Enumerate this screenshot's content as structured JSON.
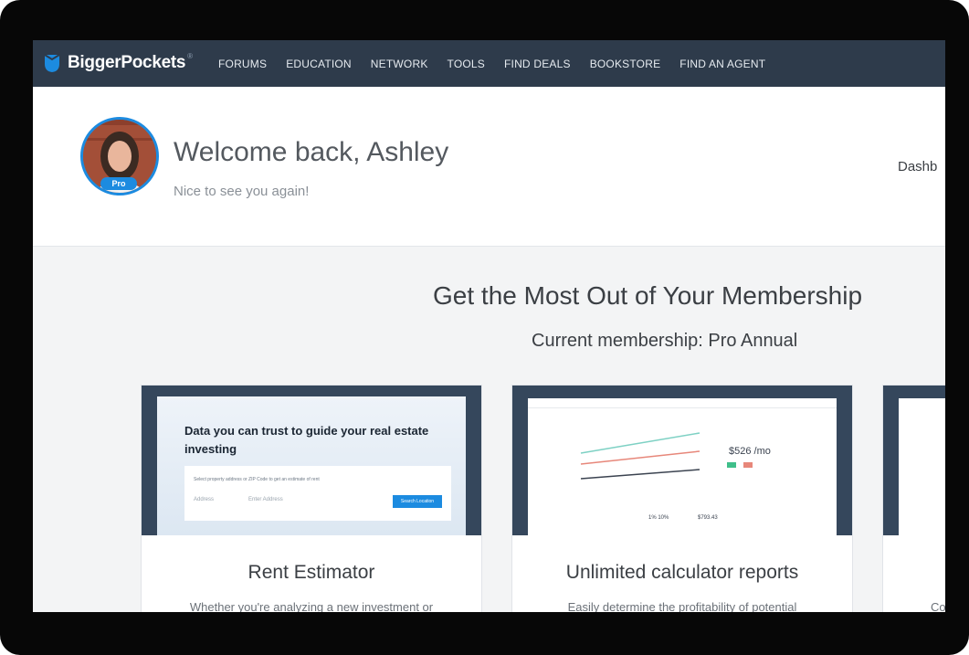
{
  "nav": {
    "brand": "BiggerPockets",
    "brand_mark": "®",
    "items": [
      "FORUMS",
      "EDUCATION",
      "NETWORK",
      "TOOLS",
      "FIND DEALS",
      "BOOKSTORE",
      "FIND AN AGENT"
    ]
  },
  "welcome": {
    "title": "Welcome back, Ashley",
    "subtitle": "Nice to see you again!",
    "badge": "Pro",
    "dashboard_link": "Dashb"
  },
  "membership": {
    "heading": "Get the Most Out of Your Membership",
    "current": "Current membership: Pro Annual"
  },
  "cards": [
    {
      "title": "Rent Estimator",
      "desc": "Whether you're analyzing a new investment or",
      "hero": {
        "headline": "Data you can trust to guide your real estate investing",
        "form_label": "Select property address or ZIP Code to get an estimate of rent",
        "field1": "Address",
        "field2": "Enter Address",
        "button": "Search Location"
      }
    },
    {
      "title": "Unlimited calculator reports",
      "desc": "Easily determine the profitability of potential",
      "hero": {
        "big_value": "$526 /mo",
        "stat1": "1% 10%",
        "stat2": "$793.43"
      }
    },
    {
      "title": "",
      "desc": "Co"
    }
  ],
  "colors": {
    "nav_bg": "#2e3b4b",
    "accent": "#1c8be0",
    "hero_bg": "#35475c"
  }
}
